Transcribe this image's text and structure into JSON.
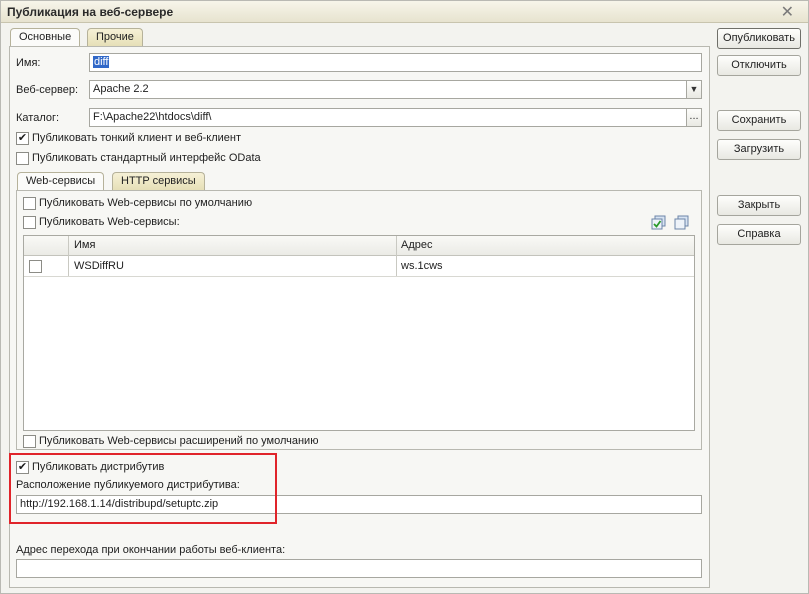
{
  "window": {
    "title": "Публикация на веб-сервере"
  },
  "tabs": [
    {
      "label": "Основные"
    },
    {
      "label": "Прочие"
    }
  ],
  "form": {
    "name_label": "Имя:",
    "name_value": "diff",
    "server_label": "Веб-сервер:",
    "server_value": "Apache 2.2",
    "catalog_label": "Каталог:",
    "catalog_value": "F:\\Apache22\\htdocs\\diff\\",
    "publish_thin_client": {
      "label": "Публиковать тонкий клиент и веб-клиент",
      "checked": true
    },
    "publish_odata": {
      "label": "Публиковать стандартный интерфейс OData",
      "checked": false
    }
  },
  "subtabs": [
    {
      "label": "Web-сервисы"
    },
    {
      "label": "HTTP сервисы"
    }
  ],
  "web_services": {
    "publish_default": {
      "label": "Публиковать Web-сервисы по умолчанию",
      "checked": false
    },
    "publish": {
      "label": "Публиковать Web-сервисы:",
      "checked": false
    },
    "table": {
      "headers": [
        "Имя",
        "Адрес"
      ],
      "rows": [
        {
          "checked": false,
          "name": "WSDiffRU",
          "address": "ws.1cws"
        }
      ]
    },
    "publish_extensions": {
      "label": "Публиковать Web-сервисы расширений по умолчанию",
      "checked": false
    }
  },
  "distributive": {
    "publish": {
      "label": "Публиковать дистрибутив",
      "checked": true
    },
    "location_label": "Расположение публикуемого дистрибутива:",
    "location_value": "http://192.168.1.14/distribupd/setuptc.zip"
  },
  "exit_url": {
    "label": "Адрес перехода при окончании работы веб-клиента:",
    "value": ""
  },
  "buttons": {
    "publish": "Опубликовать",
    "unpublish": "Отключить",
    "save": "Сохранить",
    "load": "Загрузить",
    "close": "Закрыть",
    "help": "Справка"
  },
  "check_glyph": "✔",
  "dropdown_glyph": "▼",
  "dots_glyph": "...",
  "close_glyph": "✕",
  "colors": {
    "highlight": "#e0242a",
    "selection": "#3168c8"
  }
}
